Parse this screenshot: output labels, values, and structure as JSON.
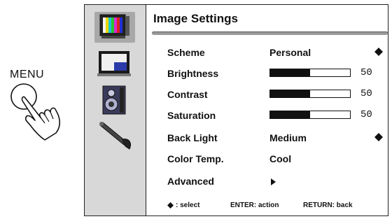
{
  "annotation": {
    "menu_label": "MENU"
  },
  "sidebar": {
    "items": [
      {
        "icon": "picture-icon",
        "selected": true
      },
      {
        "icon": "screen-icon",
        "selected": false
      },
      {
        "icon": "speaker-icon",
        "selected": false
      },
      {
        "icon": "tools-icon",
        "selected": false
      }
    ]
  },
  "header": {
    "title": "Image Settings"
  },
  "settings": {
    "scheme": {
      "label": "Scheme",
      "value": "Personal"
    },
    "brightness": {
      "label": "Brightness",
      "value": "50",
      "level": 0.5
    },
    "contrast": {
      "label": "Contrast",
      "value": "50",
      "level": 0.5
    },
    "saturation": {
      "label": "Saturation",
      "value": "50",
      "level": 0.5
    },
    "backlight": {
      "label": "Back Light",
      "value": "Medium"
    },
    "color_temp": {
      "label": "Color Temp.",
      "value": "Cool"
    },
    "advanced": {
      "label": "Advanced"
    }
  },
  "footer": {
    "select": ": select",
    "enter": "ENTER: action",
    "return": "RETURN: back"
  },
  "colors": {
    "sidebar_bg": "#d8d8d8",
    "bar_fill": "#111111",
    "title_rule": "#9a9a9a"
  }
}
